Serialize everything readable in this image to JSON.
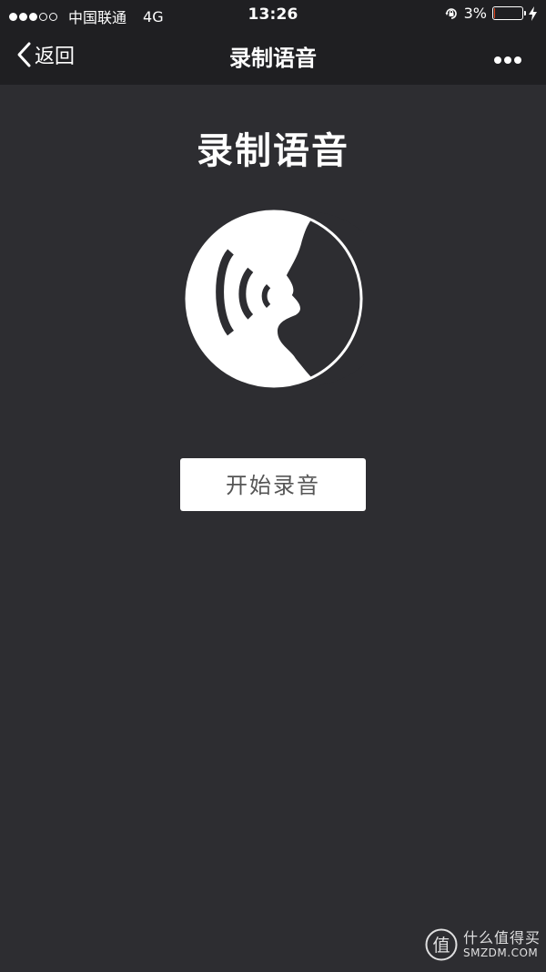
{
  "status_bar": {
    "signal_bars_filled": 3,
    "signal_bars_total": 5,
    "carrier": "中国联通",
    "network": "4G",
    "time": "13:26",
    "battery_percent": "3%",
    "battery_level": 0.03,
    "battery_color": "#e2451b"
  },
  "nav_bar": {
    "back_label": "返回",
    "title": "录制语音",
    "more_icon": "more-dots-icon"
  },
  "main": {
    "title": "录制语音",
    "icon": "voice-speaking-icon",
    "record_button_label": "开始录音"
  },
  "watermark": {
    "logo_char": "值",
    "text_cn": "什么值得买",
    "text_en": "SMZDM.COM"
  },
  "colors": {
    "background": "#2d2d31",
    "nav_background": "#1f1f22",
    "button_background": "#ffffff",
    "button_text": "#555555"
  }
}
